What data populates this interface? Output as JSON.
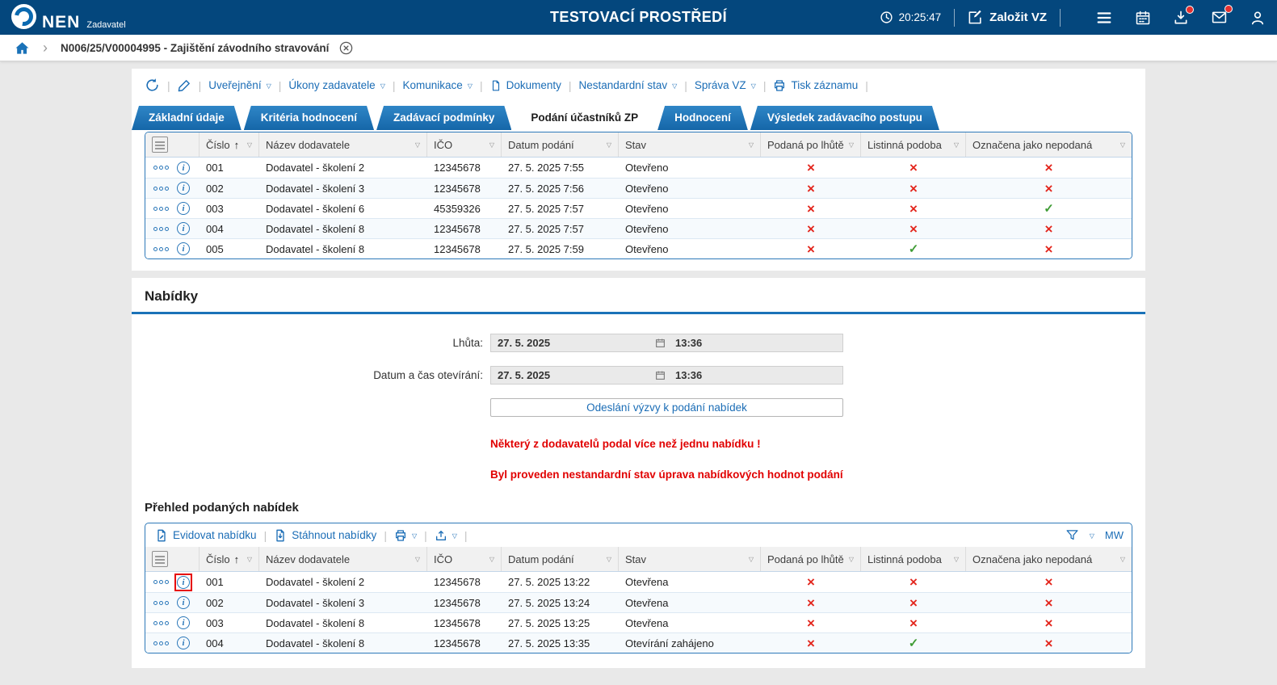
{
  "colors": {
    "header_bg": "#04477d",
    "accent_blue": "#1a72b8",
    "link_blue": "#1b6db6",
    "tab_top": "#2f86c7",
    "tab_bottom": "#1566a8",
    "error_red": "#e10000",
    "cross_red": "#e3261d",
    "check_green": "#3f9c35",
    "table_border": "#2e79b9"
  },
  "header": {
    "brand": "NEN",
    "brand_subtitle": "Zadavatel",
    "environment_title": "TESTOVACÍ PROSTŘEDÍ",
    "clock_time": "20:25:47",
    "create_button_label": "Založit VZ"
  },
  "breadcrumb": {
    "label": "N006/25/V00004995 - Zajištění závodního stravování"
  },
  "toolbar": {
    "links": [
      {
        "label": "Uveřejnění"
      },
      {
        "label": "Úkony zadavatele"
      },
      {
        "label": "Komunikace"
      },
      {
        "label": "Dokumenty"
      },
      {
        "label": "Nestandardní stav"
      },
      {
        "label": "Správa VZ"
      },
      {
        "label": "Tisk záznamu"
      }
    ]
  },
  "tabs": [
    {
      "label": "Základní údaje",
      "active": false
    },
    {
      "label": "Kritéria hodnocení",
      "active": false
    },
    {
      "label": "Zadávací podmínky",
      "active": false
    },
    {
      "label": "Podání účastníků ZP",
      "active": true
    },
    {
      "label": "Hodnocení",
      "active": false
    },
    {
      "label": "Výsledek zadávacího postupu",
      "active": false
    }
  ],
  "table_columns": {
    "cislo": "Číslo",
    "nazev": "Název dodavatele",
    "ico": "IČO",
    "datum": "Datum podání",
    "stav": "Stav",
    "po_lhute": "Podaná po lhůtě",
    "listinna": "Listinná podoba",
    "nepodana": "Označena jako nepodaná"
  },
  "submissions_table": {
    "rows": [
      {
        "cislo": "001",
        "nazev": "Dodavatel - školení 2",
        "ico": "12345678",
        "datum": "27. 5. 2025 7:55",
        "stav": "Otevřeno",
        "po_lhute": false,
        "listinna": false,
        "nepodana": false,
        "highlight_info": false
      },
      {
        "cislo": "002",
        "nazev": "Dodavatel - školení 3",
        "ico": "12345678",
        "datum": "27. 5. 2025 7:56",
        "stav": "Otevřeno",
        "po_lhute": false,
        "listinna": false,
        "nepodana": false,
        "highlight_info": false
      },
      {
        "cislo": "003",
        "nazev": "Dodavatel - školení 6",
        "ico": "45359326",
        "datum": "27. 5. 2025 7:57",
        "stav": "Otevřeno",
        "po_lhute": false,
        "listinna": false,
        "nepodana": true,
        "highlight_info": false
      },
      {
        "cislo": "004",
        "nazev": "Dodavatel - školení 8",
        "ico": "12345678",
        "datum": "27. 5. 2025 7:57",
        "stav": "Otevřeno",
        "po_lhute": false,
        "listinna": false,
        "nepodana": false,
        "highlight_info": false
      },
      {
        "cislo": "005",
        "nazev": "Dodavatel - školení 8",
        "ico": "12345678",
        "datum": "27. 5. 2025 7:59",
        "stav": "Otevřeno",
        "po_lhute": false,
        "listinna": true,
        "nepodana": false,
        "highlight_info": false
      }
    ]
  },
  "nabidky_section": {
    "title": "Nabídky",
    "lhuta_label": "Lhůta:",
    "lhuta_date": "27. 5. 2025",
    "lhuta_time": "13:36",
    "otevirani_label": "Datum a čas otevírání:",
    "otevirani_date": "27. 5. 2025",
    "otevirani_time": "13:36",
    "send_button_label": "Odeslání výzvy k podání nabídek",
    "warning1": "Některý z dodavatelů podal více než jednu nabídku !",
    "warning2": "Byl proveden nestandardní stav úprava nabídkových hodnot podání",
    "prehled_title": "Přehled podaných nabídek"
  },
  "offers_table": {
    "toolbar": {
      "evidovat_label": "Evidovat nabídku",
      "stahnout_label": "Stáhnout nabídky",
      "view_label": "MW"
    },
    "rows": [
      {
        "cislo": "001",
        "nazev": "Dodavatel - školení 2",
        "ico": "12345678",
        "datum": "27. 5. 2025 13:22",
        "stav": "Otevřena",
        "po_lhute": false,
        "listinna": false,
        "nepodana": false,
        "highlight_info": true
      },
      {
        "cislo": "002",
        "nazev": "Dodavatel - školení 3",
        "ico": "12345678",
        "datum": "27. 5. 2025 13:24",
        "stav": "Otevřena",
        "po_lhute": false,
        "listinna": false,
        "nepodana": false,
        "highlight_info": false
      },
      {
        "cislo": "003",
        "nazev": "Dodavatel - školení 8",
        "ico": "12345678",
        "datum": "27. 5. 2025 13:25",
        "stav": "Otevřena",
        "po_lhute": false,
        "listinna": false,
        "nepodana": false,
        "highlight_info": false
      },
      {
        "cislo": "004",
        "nazev": "Dodavatel - školení 8",
        "ico": "12345678",
        "datum": "27. 5. 2025 13:35",
        "stav": "Otevírání zahájeno",
        "po_lhute": false,
        "listinna": true,
        "nepodana": false,
        "highlight_info": false
      }
    ]
  }
}
